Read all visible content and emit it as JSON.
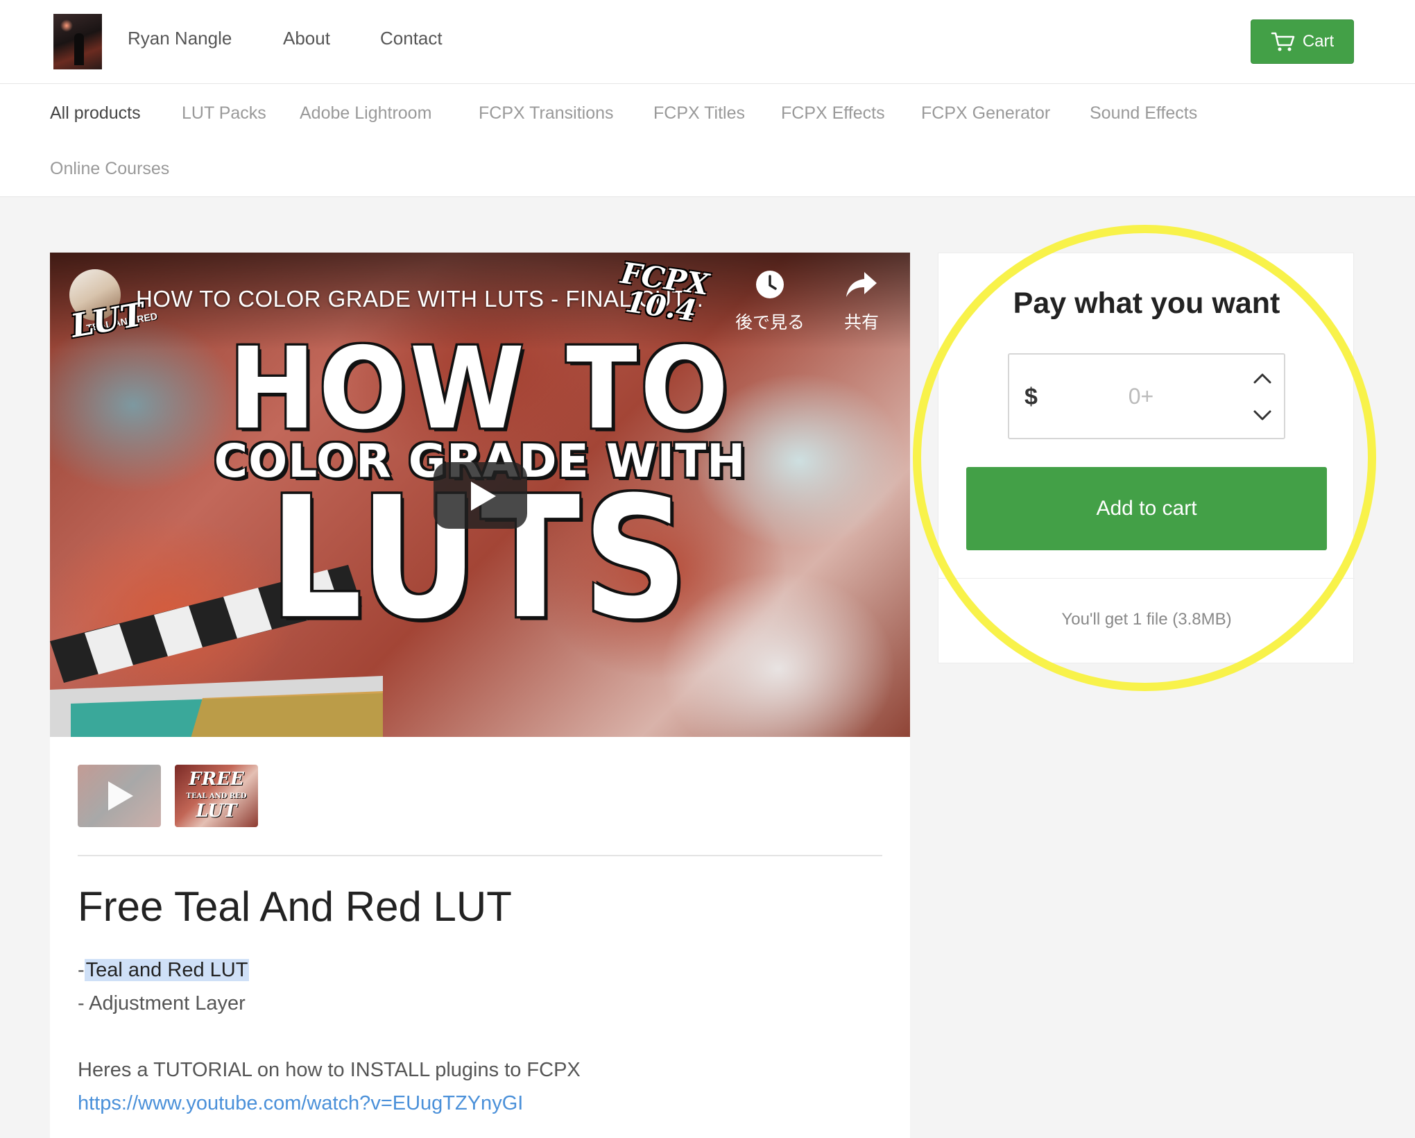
{
  "header": {
    "store_name": "Ryan Nangle",
    "nav": [
      "About",
      "Contact"
    ],
    "cart_label": "Cart"
  },
  "categories": [
    "All products",
    "LUT Packs",
    "Adobe Lightroom",
    "FCPX Transitions",
    "FCPX Titles",
    "FCPX Effects",
    "FCPX Generator",
    "Sound Effects",
    "Online Courses"
  ],
  "video": {
    "title": "HOW TO COLOR GRADE WITH LUTS - FINAL CUT...",
    "channel_logo_text": "LUT",
    "channel_logo_sub": "TEAL AND RED",
    "badge_line1": "FCPX",
    "badge_line2": "10.4",
    "watch_later_label": "後で見る",
    "share_label": "共有",
    "thumbnail_line1": "HOW TO",
    "thumbnail_line2": "COLOR GRADE WITH",
    "thumbnail_line3": "LUTS"
  },
  "thumbnails": {
    "second_line1": "FREE",
    "second_line2": "TEAL AND RED",
    "second_line3": "LUT"
  },
  "product": {
    "title": "Free Teal And Red LUT",
    "bullet1_prefix": "-",
    "bullet1_text": "Teal and Red LUT",
    "bullet2": "- Adjustment Layer",
    "tutorial_text": "Heres a TUTORIAL on how to INSTALL plugins to FCPX",
    "tutorial_link": "https://www.youtube.com/watch?v=EUugTZYnyGI"
  },
  "purchase": {
    "heading": "Pay what you want",
    "currency": "$",
    "price_placeholder": "0+",
    "add_to_cart_label": "Add to cart",
    "file_info": "You'll get 1 file (3.8MB)"
  },
  "colors": {
    "accent_green": "#43a047",
    "link_blue": "#4a90d9",
    "annotation_yellow": "#f8f24a",
    "selection_blue": "#cfe0f7"
  }
}
